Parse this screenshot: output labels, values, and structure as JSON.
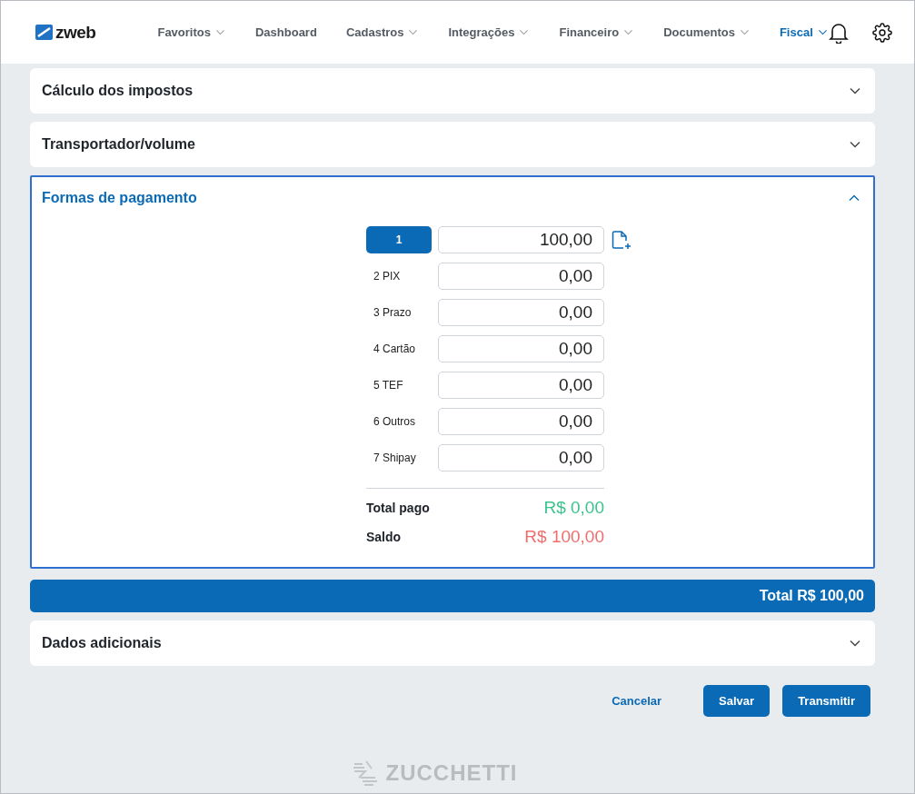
{
  "header": {
    "logo": "zweb",
    "nav": [
      {
        "label": "Favoritos",
        "dropdown": true,
        "selected": false
      },
      {
        "label": "Dashboard",
        "dropdown": false,
        "selected": false
      },
      {
        "label": "Cadastros",
        "dropdown": true,
        "selected": false
      },
      {
        "label": "Integrações",
        "dropdown": true,
        "selected": false
      },
      {
        "label": "Financeiro",
        "dropdown": true,
        "selected": false
      },
      {
        "label": "Documentos",
        "dropdown": true,
        "selected": false
      },
      {
        "label": "Fiscal",
        "dropdown": true,
        "selected": true
      }
    ]
  },
  "sections_before": [
    {
      "title": "Cálculo dos impostos",
      "expanded": false
    },
    {
      "title": "Transportador/volume",
      "expanded": false
    }
  ],
  "payment_section": {
    "title": "Formas de pagamento",
    "expanded": true,
    "rows": [
      {
        "kind": "button",
        "label": "1",
        "value": "100,00"
      },
      {
        "kind": "text",
        "label": "2 PIX",
        "value": "0,00"
      },
      {
        "kind": "text",
        "label": "3 Prazo",
        "value": "0,00"
      },
      {
        "kind": "text",
        "label": "4 Cartão",
        "value": "0,00"
      },
      {
        "kind": "text",
        "label": "5 TEF",
        "value": "0,00"
      },
      {
        "kind": "text",
        "label": "6 Outros",
        "value": "0,00"
      },
      {
        "kind": "text",
        "label": "7 Shipay",
        "value": "0,00"
      }
    ],
    "totals": [
      {
        "label": "Total pago",
        "value": "R$ 0,00",
        "color": "#3cc48f"
      },
      {
        "label": "Saldo",
        "value": "R$ 100,00",
        "color": "#f06e6e"
      }
    ]
  },
  "total_bar": "Total R$ 100,00",
  "sections_after": [
    {
      "title": "Dados adicionais",
      "expanded": false
    }
  ],
  "actions": [
    {
      "kind": "link",
      "label": "Cancelar"
    },
    {
      "kind": "primary",
      "label": "Salvar"
    },
    {
      "kind": "primary",
      "label": "Transmitir"
    }
  ],
  "footer_logo": "ZUCCHETTI"
}
